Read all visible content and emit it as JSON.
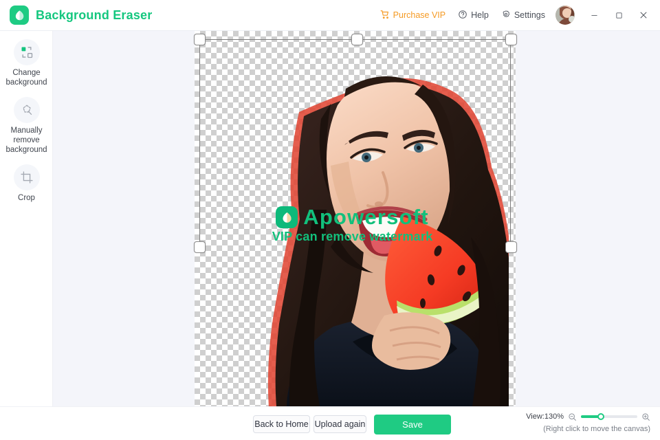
{
  "app": {
    "title": "Background Eraser",
    "logo_icon": "app-logo-icon",
    "brand_color": "#15c77f"
  },
  "header": {
    "purchase_vip": {
      "label": "Purchase VIP",
      "icon": "cart-icon",
      "color": "#f59a23"
    },
    "help": {
      "label": "Help",
      "icon": "help-circle-icon"
    },
    "settings": {
      "label": "Settings",
      "icon": "gear-icon"
    },
    "avatar": {
      "icon": "user-avatar"
    },
    "window_controls": {
      "minimize": "minimize-icon",
      "maximize": "maximize-icon",
      "close": "close-icon"
    }
  },
  "sidebar": {
    "items": [
      {
        "label": "Change background",
        "icon": "change-background-icon"
      },
      {
        "label": "Manually remove background",
        "icon": "lasso-icon"
      },
      {
        "label": "Crop",
        "icon": "crop-icon"
      }
    ]
  },
  "canvas": {
    "transparent_background": true,
    "selection": {
      "handles": 4
    },
    "watermark": {
      "brand": "Apowersoft",
      "subtitle": "VIP can remove watermark",
      "logo_icon": "apowersoft-logo-icon",
      "color": "#12c07c"
    }
  },
  "bottom": {
    "back_to_home": "Back to Home",
    "upload_again": "Upload again",
    "save": "Save",
    "save_color": "#1fcb83",
    "zoom": {
      "label": "View:130%",
      "value": 130,
      "zoom_out_icon": "zoom-out-icon",
      "zoom_in_icon": "zoom-in-icon",
      "hint": "(Right click to move the canvas)"
    }
  }
}
